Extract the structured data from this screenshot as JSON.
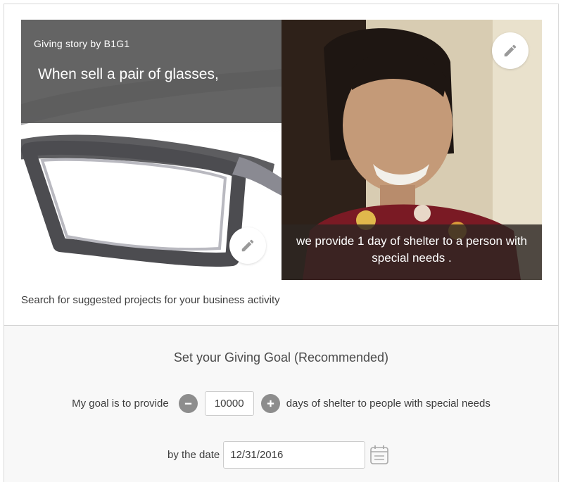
{
  "story": {
    "by_label": "Giving story by B1G1",
    "top_caption": "When sell a pair of glasses,",
    "bottom_caption": "we provide 1 day of shelter to a person with special needs .",
    "left_image_icon": "glasses-photo",
    "right_image_icon": "person-photo",
    "edit_icon": "pencil-icon"
  },
  "search_link": "Search for suggested projects for your business activity",
  "goal": {
    "title": "Set your Giving Goal (Recommended)",
    "prefix": "My goal is to provide",
    "quantity": "10000",
    "suffix": "days of shelter to people with special needs",
    "decrement_icon": "minus-circle-icon",
    "increment_icon": "plus-circle-icon"
  },
  "date": {
    "label": "by the date",
    "value": "12/31/2016",
    "icon": "calendar-icon"
  },
  "colors": {
    "caption_bg": "#585858",
    "round_button": "#8d8d8d",
    "section_bg": "#f8f8f8"
  }
}
